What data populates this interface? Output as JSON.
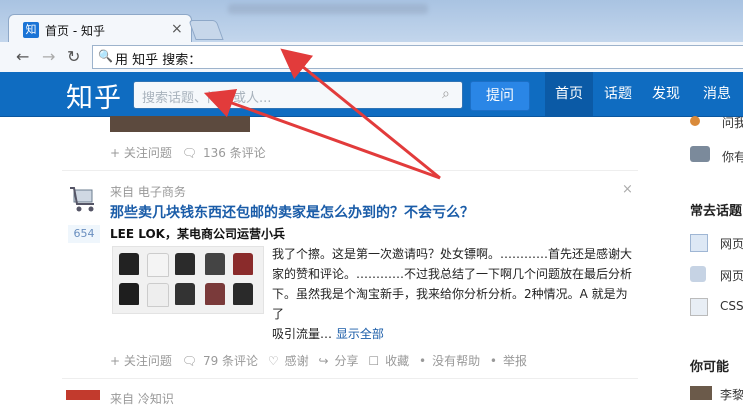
{
  "browser": {
    "tab_title": "首页 - 知乎",
    "tab_favicon": "知",
    "omnibox_text": "用 知乎 搜索："
  },
  "zhihu": {
    "logo": "知乎",
    "search_placeholder": "搜索话题、问题或人...",
    "ask_button": "提问",
    "nav": [
      "首页",
      "话题",
      "发现",
      "消息"
    ]
  },
  "feed": {
    "prev_item_actions": {
      "follow": "+ 关注问题",
      "comments": "136 条评论"
    },
    "item": {
      "source": "来自 电子商务",
      "title": "那些卖几块钱东西还包邮的卖家是怎么办到的？不会亏么？",
      "votes": "654",
      "author": "LEE LOK，某电商公司运营小兵",
      "answer_lines": [
        "我了个擦。这是第一次邀请吗？处女镖啊。…………首先还是感谢大",
        "家的赞和评论。…………不过我总结了一下啊几个问题放在最后分析",
        "下。虽然我是个淘宝新手，我来给你分析分析。2种情况。A 就是为了",
        "吸引流量…"
      ],
      "show_all": "显示全部",
      "actions": {
        "follow": "+ 关注问题",
        "comments": "79 条评论",
        "thanks": "感谢",
        "share": "分享",
        "collect": "收藏",
        "no_help": "没有帮助",
        "report": "举报"
      }
    },
    "next_item_source": "来自 冷知识"
  },
  "sidebar": {
    "items_top": [
      "问我",
      "你有"
    ],
    "common_heading": "常去话题",
    "common_items": [
      "网页",
      "网页",
      "CSS"
    ],
    "may_know_heading": "你可能",
    "may_know_item": "李黎"
  },
  "colors": {
    "zhihu_blue": "#0f6cc1",
    "link_blue": "#1a5ca8",
    "arrow_red": "#e23b3b"
  }
}
